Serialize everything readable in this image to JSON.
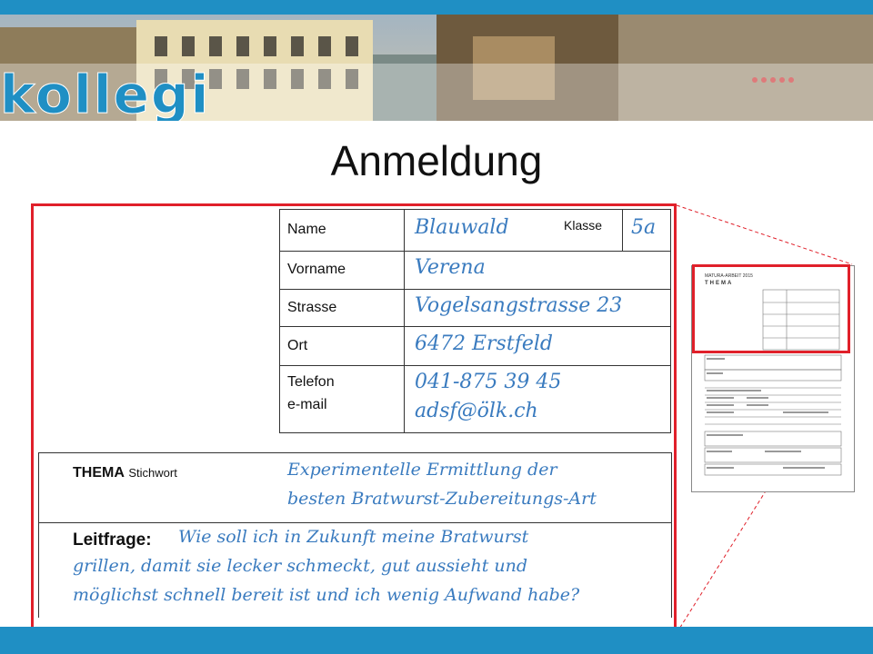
{
  "banner": {
    "logo_text": "kollegi"
  },
  "title": "Anmeldung",
  "form": {
    "name_label": "Name",
    "name_value": "Blauwald",
    "klasse_label": "Klasse",
    "klasse_value": "5a",
    "vorname_label": "Vorname",
    "vorname_value": "Verena",
    "strasse_label": "Strasse",
    "strasse_value": "Vogelsangstrasse 23",
    "ort_label": "Ort",
    "ort_value": "6472 Erstfeld",
    "telefon_label": "Telefon",
    "email_label": "e-mail",
    "telefon_value": "041-875 39 45",
    "email_value": "adsf@ölk.ch"
  },
  "thema": {
    "label": "THEMA",
    "sublabel": "Stichwort",
    "value_line1": "Experimentelle Ermittlung der",
    "value_line2": "besten Bratwurst-Zubereitungs-Art"
  },
  "leitfrage": {
    "label": "Leitfrage:",
    "line1": "Wie soll ich in Zukunft meine Bratwurst",
    "line2": "grillen, damit sie lecker schmeckt, gut aussieht und",
    "line3": "möglichst schnell bereit ist und ich wenig Aufwand habe?"
  },
  "thumbnail": {
    "header": "MATURA-ARBEIT 2015",
    "subheader": "THEMA"
  },
  "colors": {
    "accent": "#1f8fc4",
    "highlight": "#e0202a",
    "handwriting": "#3a7bbf"
  }
}
